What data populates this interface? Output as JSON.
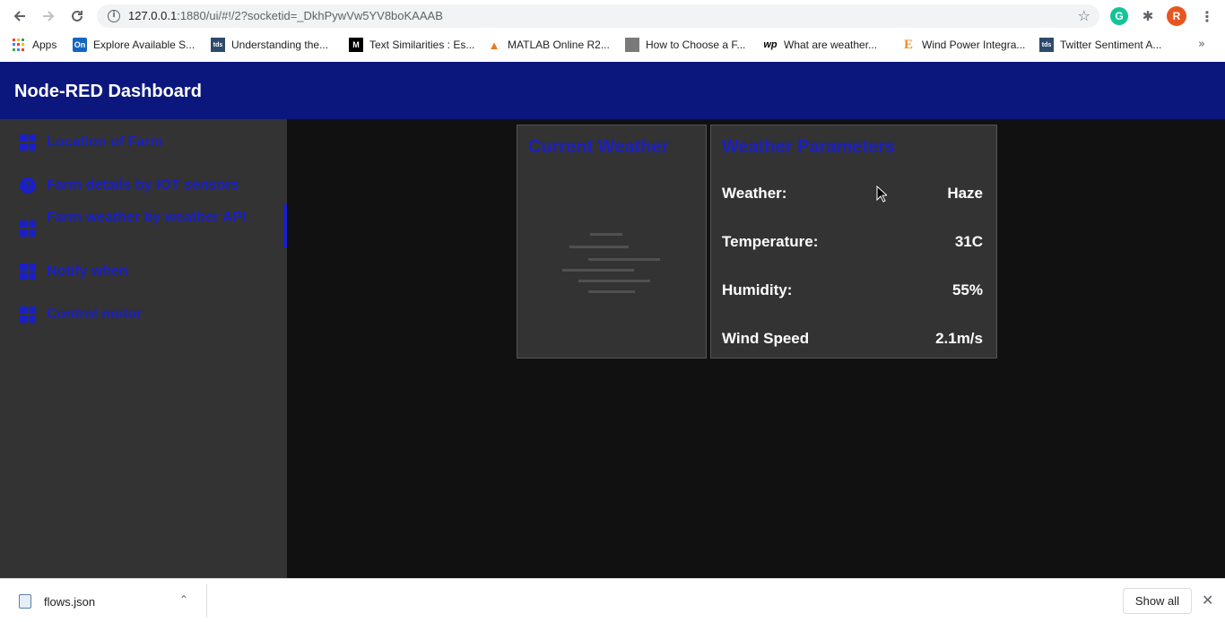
{
  "browser": {
    "url_host": "127.0.0.1",
    "url_rest": ":1880/ui/#!/2?socketid=_DkhPywVw5YV8boKAAAB",
    "profile_initial": "R",
    "grammarly_initial": "G"
  },
  "bookmarks": [
    {
      "label": "Apps",
      "icon": "apps-grid-icon"
    },
    {
      "label": "Explore Available S...",
      "icon": "on-icon",
      "fav": "On",
      "color": "#1565c0"
    },
    {
      "label": "Understanding the...",
      "icon": "tds-icon",
      "fav": "tds",
      "color": "#2e4a6b"
    },
    {
      "label": "Text Similarities : Es...",
      "icon": "medium-icon",
      "fav": "M",
      "color": "#000000"
    },
    {
      "label": "MATLAB Online R2...",
      "icon": "matlab-icon",
      "fav": "▲",
      "color": "#e87722"
    },
    {
      "label": "How to Choose a F...",
      "icon": "avatar-icon",
      "fav": "",
      "color": "#7a7a7a"
    },
    {
      "label": "What are weather...",
      "icon": "wp-icon",
      "fav": "wp",
      "color": "#000000"
    },
    {
      "label": "Wind Power Integra...",
      "icon": "e-icon",
      "fav": "E",
      "color": "#f08a24"
    },
    {
      "label": "Twitter Sentiment A...",
      "icon": "tds-icon",
      "fav": "tds",
      "color": "#2e4a6b"
    }
  ],
  "app": {
    "title": "Node-RED Dashboard"
  },
  "sidebar": {
    "items": [
      {
        "label": "Location of Farm",
        "icon": "dashboard-icon"
      },
      {
        "label": "Farm details by IOT sensors",
        "icon": "help-icon"
      },
      {
        "label": "Farm weather by weather API",
        "icon": "dashboard-icon"
      },
      {
        "label": "Notify when",
        "icon": "dashboard-icon"
      },
      {
        "label": "Control motor",
        "icon": "dashboard-icon"
      }
    ]
  },
  "current_weather": {
    "title": "Current Weather",
    "icon": "haze-weather-icon"
  },
  "params": {
    "title": "Weather Parameters",
    "rows": [
      {
        "label": "Weather:",
        "value": "Haze"
      },
      {
        "label": "Temperature:",
        "value": "31C"
      },
      {
        "label": "Humidity:",
        "value": "55%"
      },
      {
        "label": "Wind Speed",
        "value": "2.1m/s"
      }
    ]
  },
  "downloads": {
    "file_name": "flows.json",
    "show_all": "Show all"
  },
  "colors": {
    "header": "#0c177e",
    "accent": "#1a1fc9",
    "sidebar": "#333333",
    "card": "#333333",
    "background": "#111111"
  }
}
